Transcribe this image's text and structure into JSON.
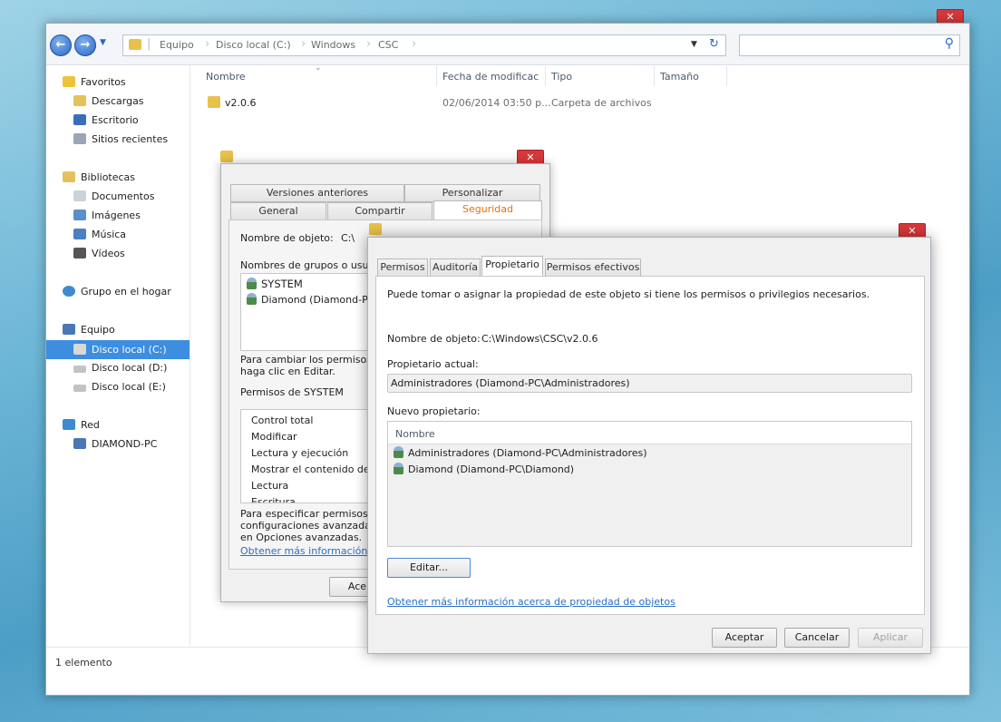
{
  "explorer": {
    "breadcrumbs": [
      "Equipo",
      "Disco local (C:)",
      "Windows",
      "CSC"
    ],
    "search_placeholder": "",
    "sidebar": {
      "favorites": "Favoritos",
      "fav_items": [
        "Descargas",
        "Escritorio",
        "Sitios recientes"
      ],
      "libraries": "Bibliotecas",
      "lib_items": [
        "Documentos",
        "Imágenes",
        "Música",
        "Vídeos"
      ],
      "homegroup": "Grupo en el hogar",
      "computer": "Equipo",
      "drives": [
        "Disco local (C:)",
        "Disco local (D:)",
        "Disco local (E:)"
      ],
      "network": "Red",
      "net_items": [
        "DIAMOND-PC"
      ]
    },
    "columns": [
      "Nombre",
      "Fecha de modificac",
      "Tipo",
      "Tamaño"
    ],
    "files": [
      {
        "name": "v2.0.6",
        "date": "02/06/2014 03:50 p...",
        "type": "Carpeta de archivos"
      }
    ],
    "status": "1 elemento"
  },
  "props": {
    "tabs_row1": [
      "Versiones anteriores",
      "Personalizar"
    ],
    "tabs_row2": [
      "General",
      "Compartir",
      "Seguridad"
    ],
    "object_name_label": "Nombre de objeto:",
    "object_name_value": "C:\\",
    "groups_label": "Nombres de grupos o usuario",
    "groups": [
      "SYSTEM",
      "Diamond (Diamond-PC"
    ],
    "change_hint_1": "Para cambiar los permisos,",
    "change_hint_2": "haga clic en Editar.",
    "perms_for": "Permisos de SYSTEM",
    "perms": [
      "Control total",
      "Modificar",
      "Lectura y ejecución",
      "Mostrar el contenido de la",
      "Lectura",
      "Escritura"
    ],
    "special_1": "Para especificar permisos es",
    "special_2": "configuraciones avanzadas,",
    "special_3": "en Opciones avanzadas.",
    "more_info": "Obtener más información ace",
    "ok_btn": "Ace"
  },
  "adv": {
    "tabs": [
      "Permisos",
      "Auditoría",
      "Propietario",
      "Permisos efectivos"
    ],
    "intro": "Puede tomar o asignar la propiedad de este objeto si tiene los permisos o privilegios necesarios.",
    "object_name_label": "Nombre de objeto:",
    "object_name_value": "C:\\Windows\\CSC\\v2.0.6",
    "current_owner_label": "Propietario actual:",
    "current_owner": "Administradores (Diamond-PC\\Administradores)",
    "new_owner_label": "Nuevo propietario:",
    "list_header": "Nombre",
    "owners": [
      "Administradores (Diamond-PC\\Administradores)",
      "Diamond (Diamond-PC\\Diamond)"
    ],
    "edit_btn": "Editar...",
    "more_info": "Obtener más información acerca de propiedad de objetos",
    "accept": "Aceptar",
    "cancel": "Cancelar",
    "apply": "Aplicar"
  },
  "icons": {
    "close": "✕",
    "back": "←",
    "forward": "→",
    "search": "⚲"
  }
}
